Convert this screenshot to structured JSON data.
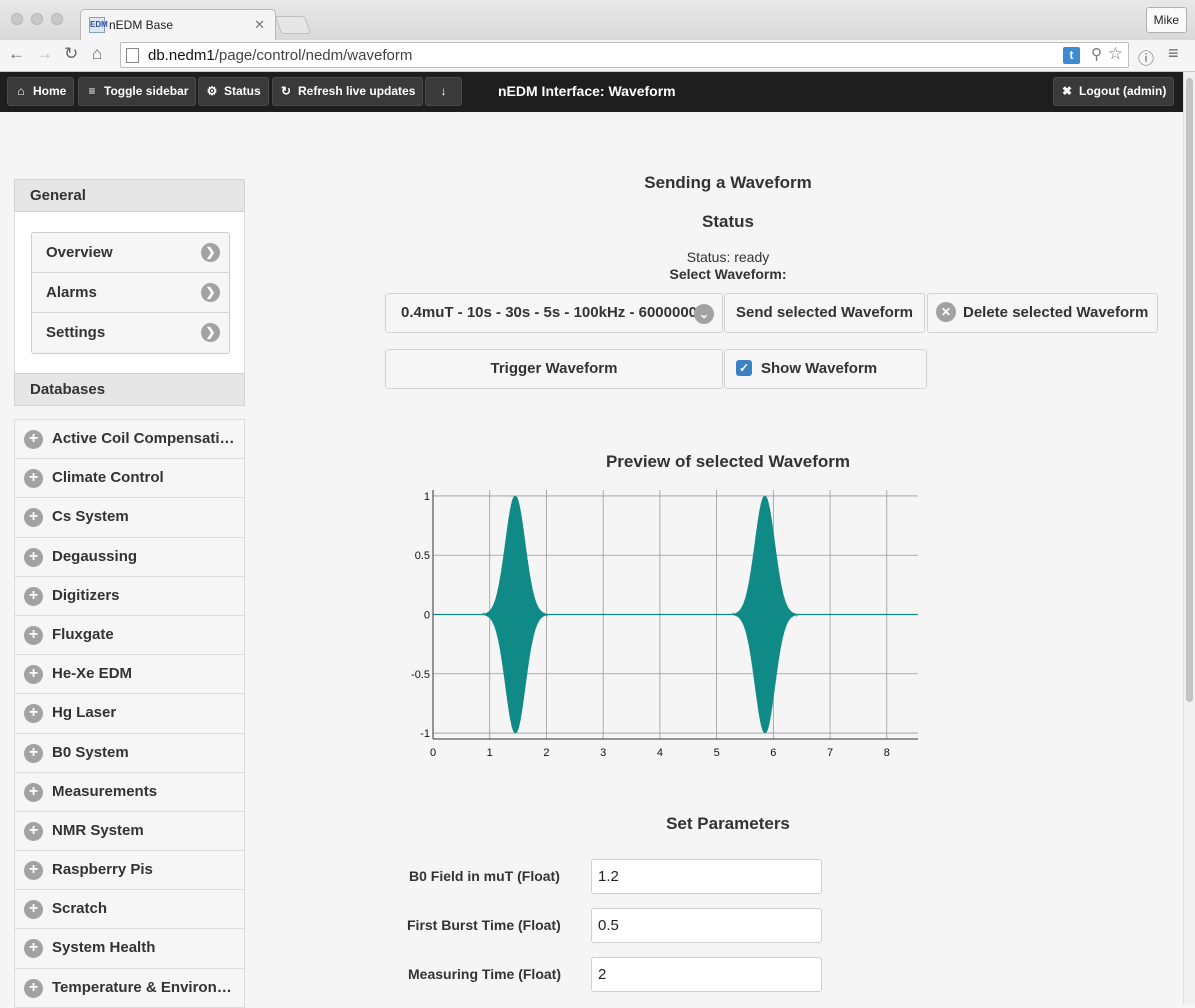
{
  "browser": {
    "tab_title": "nEDM Base",
    "tab_favicon": "EDM",
    "user_button": "Mike",
    "url_host": "db.nedm1",
    "url_path": "/page/control/nedm/waveform"
  },
  "navbar": {
    "home": "Home",
    "toggle_sidebar": "Toggle sidebar",
    "status": "Status",
    "refresh": "Refresh live updates",
    "title": "nEDM Interface: Waveform",
    "logout": "Logout (admin)"
  },
  "sidebar": {
    "general_header": "General",
    "general_items": [
      "Overview",
      "Alarms",
      "Settings"
    ],
    "databases_header": "Databases",
    "databases": [
      "Active Coil Compensati…",
      "Climate Control",
      "Cs System",
      "Degaussing",
      "Digitizers",
      "Fluxgate",
      "He-Xe EDM",
      "Hg Laser",
      "B0 System",
      "Measurements",
      "NMR System",
      "Raspberry Pis",
      "Scratch",
      "System Health",
      "Temperature & Environ…"
    ]
  },
  "main": {
    "heading": "Sending a Waveform",
    "status_heading": "Status",
    "status_text": "Status: ready",
    "select_label": "Select Waveform:",
    "selected_waveform": "0.4muT - 10s - 30s - 5s - 100kHz - 6000000",
    "send_button": "Send selected Waveform",
    "delete_button": "Delete selected Waveform",
    "trigger_button": "Trigger Waveform",
    "show_waveform_label": "Show Waveform",
    "show_waveform_checked": true,
    "preview_heading": "Preview of selected Waveform",
    "params_heading": "Set Parameters",
    "params": [
      {
        "label": "B0 Field in muT (Float)",
        "value": "1.2"
      },
      {
        "label": "First Burst Time (Float)",
        "value": "0.5"
      },
      {
        "label": "Measuring Time (Float)",
        "value": "2"
      }
    ]
  },
  "chart_data": {
    "type": "line",
    "xlim": [
      0,
      8.55
    ],
    "ylim": [
      -1.05,
      1.05
    ],
    "x_ticks": [
      0,
      1,
      2,
      3,
      4,
      5,
      6,
      7,
      8
    ],
    "y_ticks": [
      -1,
      -0.5,
      0,
      0.5,
      1
    ],
    "y_tick_labels": [
      "-1",
      "-0.5",
      "0",
      "0.5",
      "1"
    ],
    "grid": true,
    "color": "#0f8a86",
    "bursts": [
      {
        "center": 1.45,
        "amplitude": 1.0,
        "width": 0.17
      },
      {
        "center": 5.85,
        "amplitude": 1.0,
        "width": 0.17
      }
    ]
  }
}
